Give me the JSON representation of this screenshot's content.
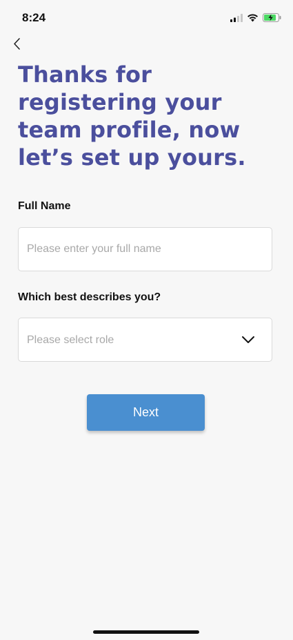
{
  "status_bar": {
    "time": "8:24",
    "icons": [
      "cellular-signal-icon",
      "wifi-icon",
      "battery-charging-icon"
    ],
    "battery_color": "#4cd964"
  },
  "nav": {
    "back_icon": "chevron-left-icon"
  },
  "heading": "Thanks for registering your team profile, now let’s set up yours.",
  "full_name": {
    "label": "Full Name",
    "placeholder": "Please enter your full name",
    "value": ""
  },
  "role": {
    "label": "Which best describes you?",
    "placeholder": "Please select role",
    "icon": "chevron-down-icon"
  },
  "next_button": {
    "label": "Next"
  },
  "colors": {
    "heading": "#4b4f9d",
    "button": "#4a8fd0",
    "background": "#f7f7f7"
  }
}
